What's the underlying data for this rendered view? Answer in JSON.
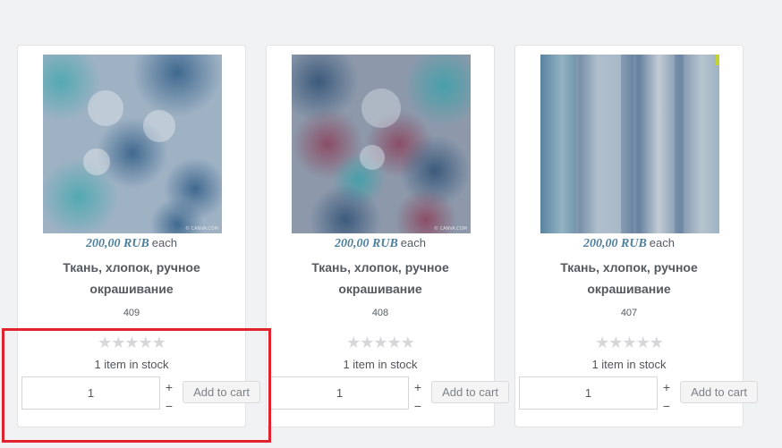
{
  "products": [
    {
      "price": "200,00 RUB",
      "price_unit": "each",
      "title": "Ткань, хлопок, ручное окрашивание",
      "sku": "409",
      "stars": "★★★★★",
      "stock": "1 item in stock",
      "quantity": "1",
      "plus": "+",
      "minus": "−",
      "add_to_cart": "Add to cart",
      "watermark": "© CANVA.COM"
    },
    {
      "price": "200,00 RUB",
      "price_unit": "each",
      "title": "Ткань, хлопок, ручное окрашивание",
      "sku": "408",
      "stars": "★★★★★",
      "stock": "1 item in stock",
      "quantity": "1",
      "plus": "+",
      "minus": "−",
      "add_to_cart": "Add to cart",
      "watermark": "© CANVA.COM"
    },
    {
      "price": "200,00 RUB",
      "price_unit": "each",
      "title": "Ткань, хлопок, ручное окрашивание",
      "sku": "407",
      "stars": "★★★★★",
      "stock": "1 item in stock",
      "quantity": "1",
      "plus": "+",
      "minus": "−",
      "add_to_cart": "Add to cart",
      "watermark": ""
    }
  ],
  "rating": 0,
  "colors": {
    "price": "#4e7f9e",
    "highlight": "#e0232c",
    "star_empty": "#d6d7d9"
  }
}
